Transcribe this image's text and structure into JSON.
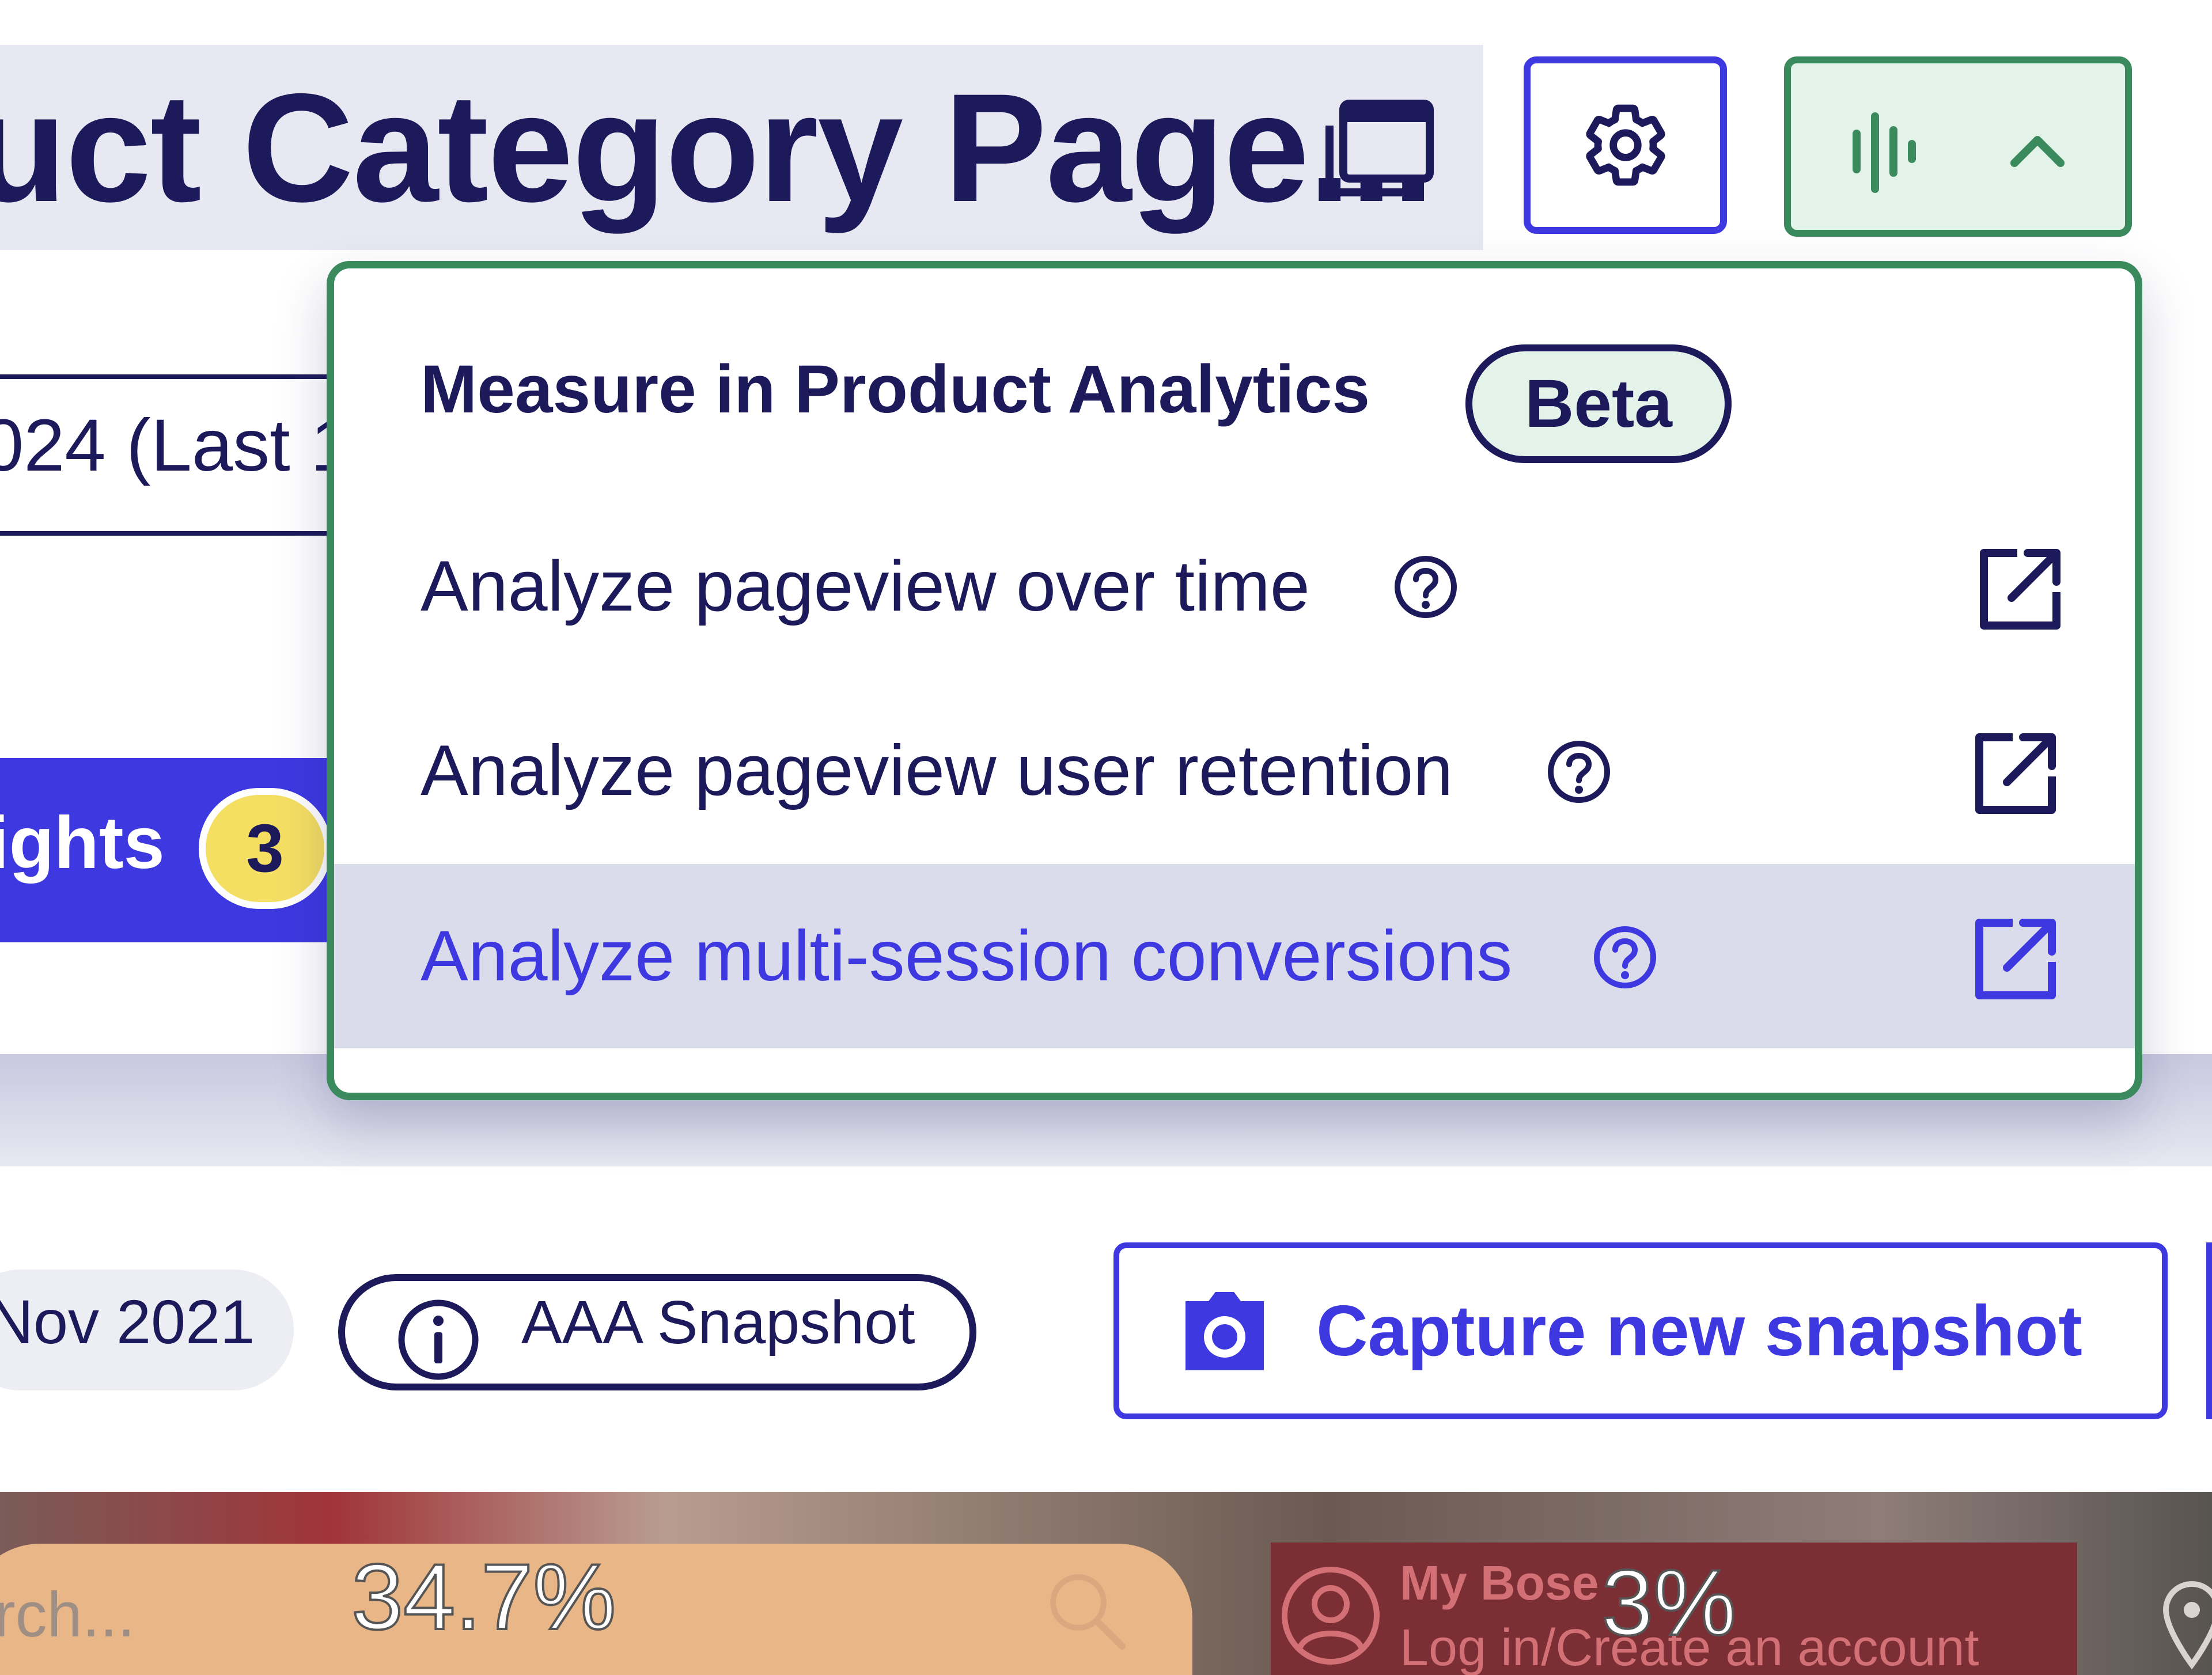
{
  "header": {
    "page_title": "uct Category Page..."
  },
  "background": {
    "date_range_text": "024 (Last 1",
    "insights_label": "ights",
    "insights_count": "3"
  },
  "dropdown": {
    "heading": "Measure in Product Analytics",
    "badge": "Beta",
    "items": [
      {
        "label": "Analyze pageview over time"
      },
      {
        "label": "Analyze pageview user retention"
      },
      {
        "label": "Analyze multi-session conversions",
        "state": "hover"
      }
    ]
  },
  "snapshot_bar": {
    "date_chip": "Nov 2021",
    "snapshot_chip": "AAA Snapshot",
    "capture_button": "Capture new snapshot"
  },
  "heatmap": {
    "search_placeholder": "rch...",
    "search_percent": "34.7%",
    "account_title": "My Bose",
    "account_subtitle": "Log in/Create an account",
    "account_percent": "3%"
  },
  "colors": {
    "primary": "#3d38e0",
    "navy": "#1c1a5a",
    "green_border": "#3a8a5e",
    "green_bg": "#e4f3ea",
    "badge_yellow": "#f5df62",
    "hover_bg": "#dadbeb"
  },
  "icons": {
    "title": "copy-window-icon",
    "settings": "gear-icon",
    "analytics": "bar-chart-icon",
    "toggle": "chevron-up-icon",
    "help": "question-circle-icon",
    "external": "external-link-icon",
    "info": "info-circle-icon",
    "camera": "camera-icon",
    "search": "search-icon",
    "user": "user-circle-icon",
    "pin": "map-pin-icon"
  }
}
